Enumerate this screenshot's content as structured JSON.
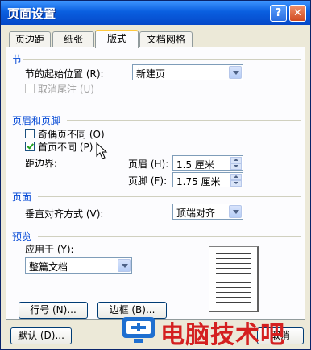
{
  "window": {
    "title": "页面设置"
  },
  "titlebar": {
    "help": "?",
    "close": "✕"
  },
  "tabs": [
    "页边距",
    "纸张",
    "版式",
    "文档网格"
  ],
  "section": {
    "group_label": "节",
    "start_label": "节的起始位置 (R):",
    "start_value": "新建页",
    "suppress_endnotes": "取消尾注 (U)"
  },
  "headers_footers": {
    "group_label": "页眉和页脚",
    "odd_even": "奇偶页不同 (O)",
    "odd_even_checked": false,
    "first_page": "首页不同 (P)",
    "first_page_checked": true,
    "from_edge": "距边界:",
    "header_label": "页眉 (H):",
    "header_value": "1.5 厘米",
    "footer_label": "页脚 (F):",
    "footer_value": "1.75 厘米"
  },
  "page": {
    "group_label": "页面",
    "valign_label": "垂直对齐方式 (V):",
    "valign_value": "顶端对齐"
  },
  "preview": {
    "group_label": "预览",
    "apply_label": "应用于 (Y):",
    "apply_value": "整篇文档"
  },
  "buttons": {
    "line_numbers": "行号 (N)...",
    "borders": "边框 (B)...",
    "default": "默认 (D)...",
    "cancel": "取消"
  },
  "watermark": {
    "text": "电脑技术吧"
  }
}
